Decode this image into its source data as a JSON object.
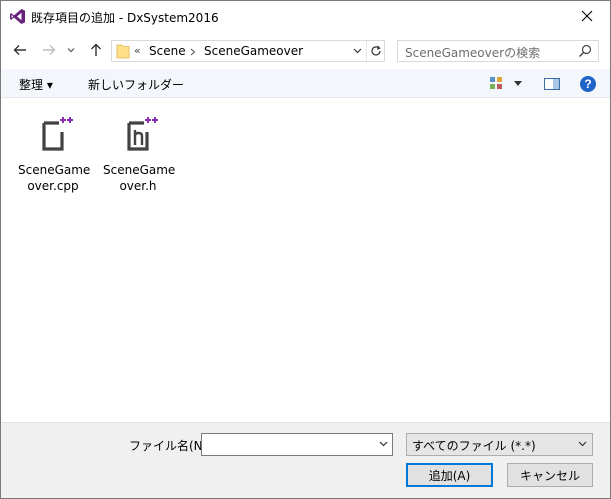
{
  "window": {
    "title": "既存項目の追加 - DxSystem2016",
    "colors": {
      "accent": "#0078d7",
      "vs_purple": "#68217a",
      "help_blue": "#1e64c8"
    }
  },
  "nav": {
    "breadcrumb_overflow": "«",
    "breadcrumb": [
      "Scene",
      "SceneGameover"
    ],
    "search_placeholder": "SceneGameoverの検索"
  },
  "toolbar": {
    "organize_label": "整理 ▾",
    "new_folder_label": "新しいフォルダー"
  },
  "files": [
    {
      "line1": "SceneGame",
      "line2": "over.cpp",
      "icon": "cpp-file-icon"
    },
    {
      "line1": "SceneGame",
      "line2": "over.h",
      "icon": "header-file-icon"
    }
  ],
  "bottom": {
    "filename_label": "ファイル名(N):",
    "filename_value": "",
    "filetype_value": "すべてのファイル (*.*)",
    "add_button": "追加(A)",
    "cancel_button": "キャンセル"
  }
}
